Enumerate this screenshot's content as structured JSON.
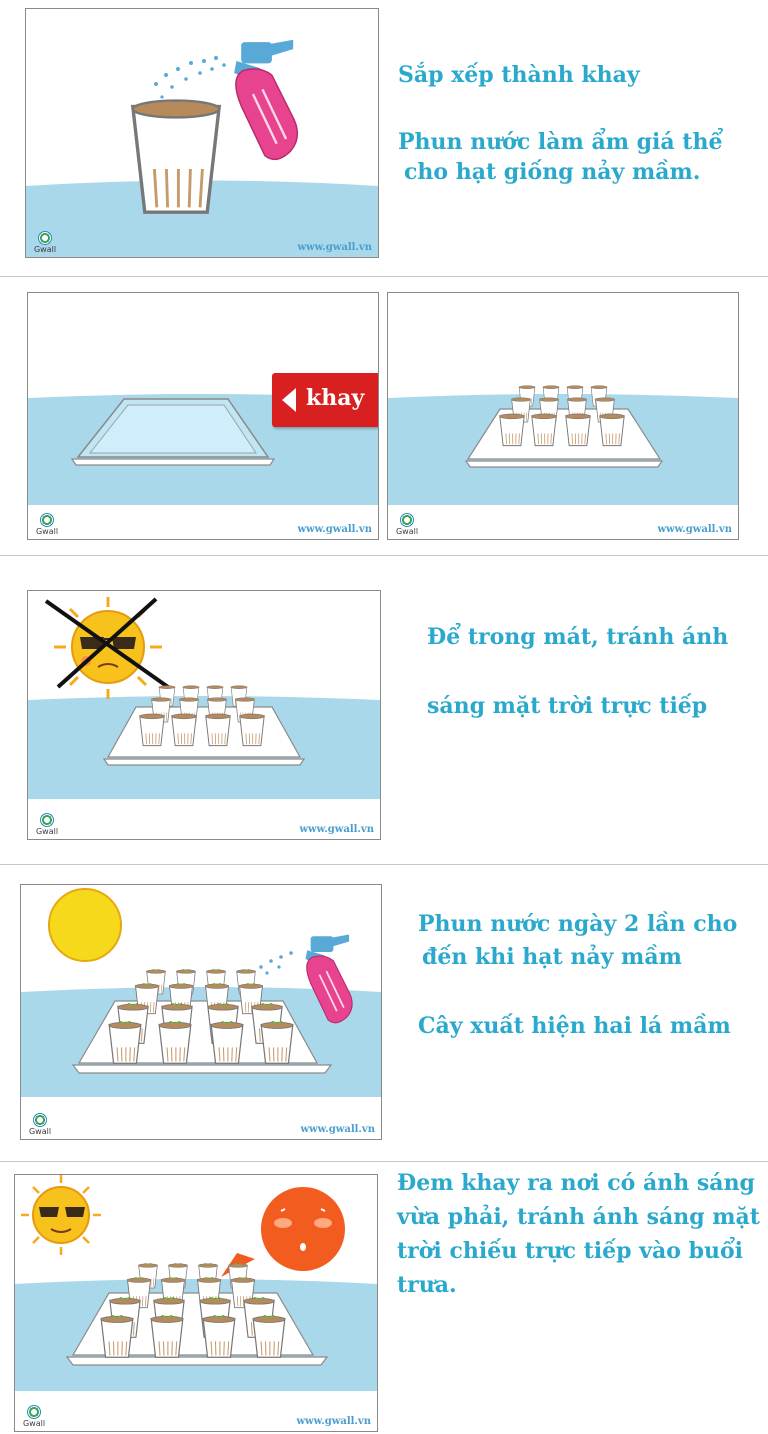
{
  "brand": {
    "logo_name": "Gwall",
    "url": "www.gwall.vn"
  },
  "step1": {
    "line1": "Sắp xếp thành khay",
    "line2": "Phun nước làm ẩm giá thể",
    "line3": "cho hạt giống nảy mầm."
  },
  "step2": {
    "tray_label": "khay"
  },
  "step3": {
    "line1": "Để trong mát, tránh ánh",
    "line2": "sáng mặt trời trực tiếp"
  },
  "step4": {
    "line1": "Phun nước ngày 2 lần cho",
    "line2": "đến khi hạt nảy mầm",
    "line3": "Cây xuất hiện hai lá mầm"
  },
  "step5": {
    "line1": "Đem khay ra nơi có ánh sáng",
    "line2": "vừa phải, tránh ánh sáng mặt",
    "line3": "trời chiếu trực tiếp vào buổi",
    "line4": "trưa."
  },
  "colors": {
    "caption": "#2aa9cc",
    "water": "#a9d8ea",
    "tray_label": "#d7201f",
    "sun": "#f7c21b",
    "spray_bottle": "#e8438e"
  },
  "icons": [
    "spray-bottle-icon",
    "seed-cup-icon",
    "tray-icon",
    "sun-icon",
    "crossed-sun-icon",
    "speech-bubble-icon",
    "gwall-logo-icon"
  ]
}
